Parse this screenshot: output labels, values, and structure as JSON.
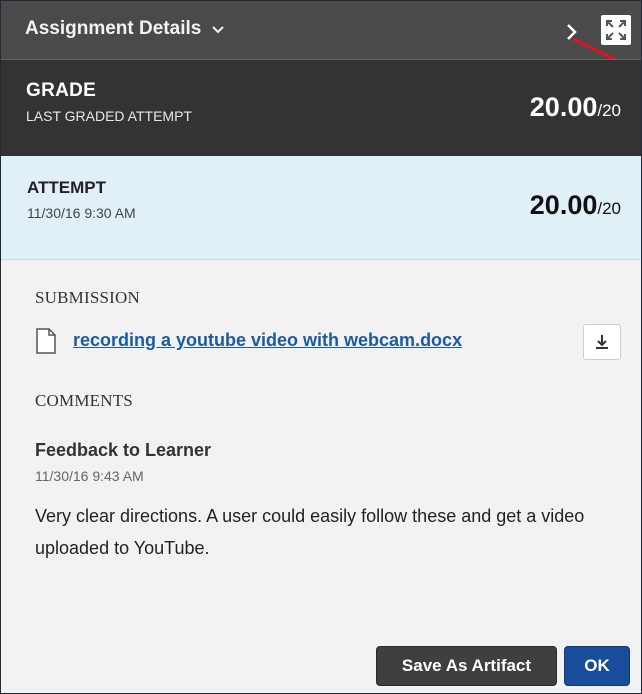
{
  "header": {
    "title": "Assignment Details",
    "chevron_icon": "chevron-down-icon",
    "next_icon": "chevron-right-icon",
    "expand_icon": "expand-icon"
  },
  "grade": {
    "label": "GRADE",
    "sublabel": "LAST GRADED ATTEMPT",
    "score": "20.00",
    "out_of": "/20"
  },
  "attempt": {
    "label": "ATTEMPT",
    "date": "11/30/16 9:30 AM",
    "score": "20.00",
    "out_of": "/20"
  },
  "submission": {
    "heading": "SUBMISSION",
    "file_icon": "document-icon",
    "file_name": "recording a youtube video with webcam.docx",
    "download_icon": "download-icon"
  },
  "comments": {
    "heading": "COMMENTS",
    "feedback_title": "Feedback to Learner",
    "feedback_date": "11/30/16 9:43 AM",
    "feedback_text": "Very clear directions. A user could easily follow these and get a video uploaded to YouTube."
  },
  "actions": {
    "save_artifact_label": "Save As Artifact",
    "ok_label": "OK"
  },
  "colors": {
    "header_bg": "#4a4a4a",
    "grade_bg": "#333333",
    "attempt_bg": "#e1f0f6",
    "link": "#1a5aa6",
    "ok_button": "#1a4c9c",
    "annotation_arrow": "#e0141e"
  }
}
